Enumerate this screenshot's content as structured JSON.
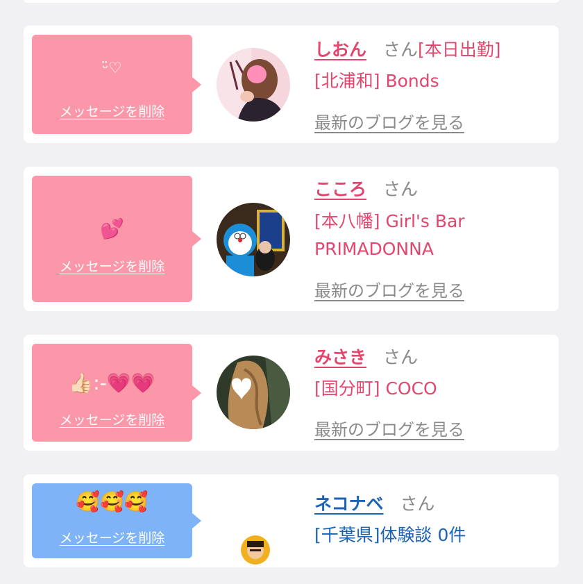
{
  "messages": [
    {
      "message": "ᵕ̈♡",
      "delete_label": "メッセージを削除",
      "name": "しおん",
      "san": "さん",
      "status": "[本日出勤]",
      "shop_lines": [
        "[北浦和] Bonds"
      ],
      "blog_label": "最新のブログを見る"
    },
    {
      "message": "💕",
      "delete_label": "メッセージを削除",
      "name": "こころ",
      "san": "さん",
      "status": "",
      "shop_lines": [
        "[本八幡] Girl's Bar",
        "PRIMADONNA"
      ],
      "blog_label": "最新のブログを見る"
    },
    {
      "message": "👍🏻:-💗💗",
      "delete_label": "メッセージを削除",
      "name": "みさき",
      "san": "さん",
      "status": "",
      "shop_lines": [
        "[国分町] COCO"
      ],
      "blog_label": "最新のブログを見る"
    },
    {
      "message": "🥰🥰🥰",
      "delete_label": "メッセージを削除",
      "name": "ネコナベ",
      "san": "さん",
      "status": "",
      "shop_lines": [
        "[千葉県]体験談 0件"
      ],
      "blog_label": ""
    }
  ],
  "colors": {
    "pink_bubble": "#fb97a8",
    "blue_bubble": "#7eb3f8",
    "pink_text": "#e2466d",
    "blue_text": "#1b63b5",
    "background": "#f1f1f3"
  }
}
